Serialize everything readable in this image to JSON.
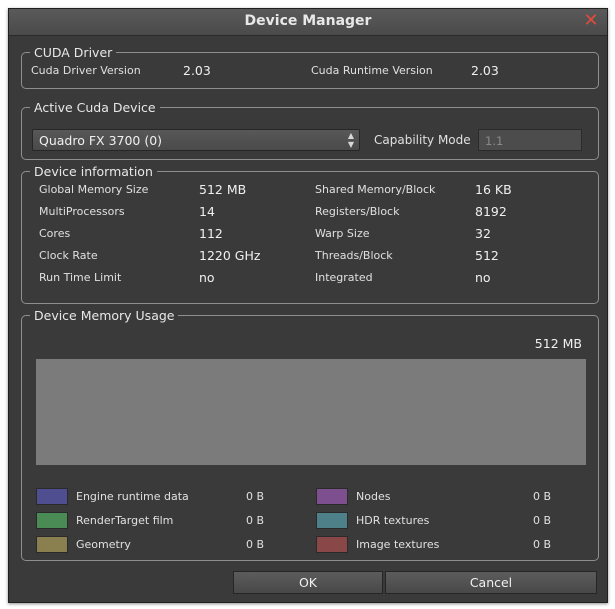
{
  "window": {
    "title": "Device Manager"
  },
  "cuda_driver": {
    "legend": "CUDA Driver",
    "driver_version_label": "Cuda Driver Version",
    "driver_version": "2.03",
    "runtime_version_label": "Cuda Runtime Version",
    "runtime_version": "2.03"
  },
  "active_device": {
    "legend": "Active Cuda Device",
    "selected_device": "Quadro FX 3700 (0)",
    "capability_label": "Capability Mode",
    "capability_value": "1.1"
  },
  "device_info": {
    "legend": "Device information",
    "rows": [
      {
        "l1": "Global Memory Size",
        "v1": "512 MB",
        "l2": "Shared Memory/Block",
        "v2": "16 KB"
      },
      {
        "l1": "MultiProcessors",
        "v1": "14",
        "l2": "Registers/Block",
        "v2": "8192"
      },
      {
        "l1": "Cores",
        "v1": "112",
        "l2": "Warp Size",
        "v2": "32"
      },
      {
        "l1": "Clock Rate",
        "v1": "1220 GHz",
        "l2": "Threads/Block",
        "v2": "512"
      },
      {
        "l1": "Run Time Limit",
        "v1": "no",
        "l2": "Integrated",
        "v2": "no"
      }
    ]
  },
  "memory_usage": {
    "legend": "Device Memory Usage",
    "total": "512 MB",
    "used_fraction": 0,
    "items": [
      {
        "label": "Engine runtime data",
        "value": "0 B",
        "color": "#4e4e91"
      },
      {
        "label": "Nodes",
        "value": "0 B",
        "color": "#7e4f8f"
      },
      {
        "label": "RenderTarget film",
        "value": "0 B",
        "color": "#4a8a54"
      },
      {
        "label": "HDR textures",
        "value": "0 B",
        "color": "#4d8089"
      },
      {
        "label": "Geometry",
        "value": "0 B",
        "color": "#8a7f4e"
      },
      {
        "label": "Image textures",
        "value": "0 B",
        "color": "#8a4747"
      }
    ]
  },
  "buttons": {
    "ok": "OK",
    "cancel": "Cancel"
  }
}
